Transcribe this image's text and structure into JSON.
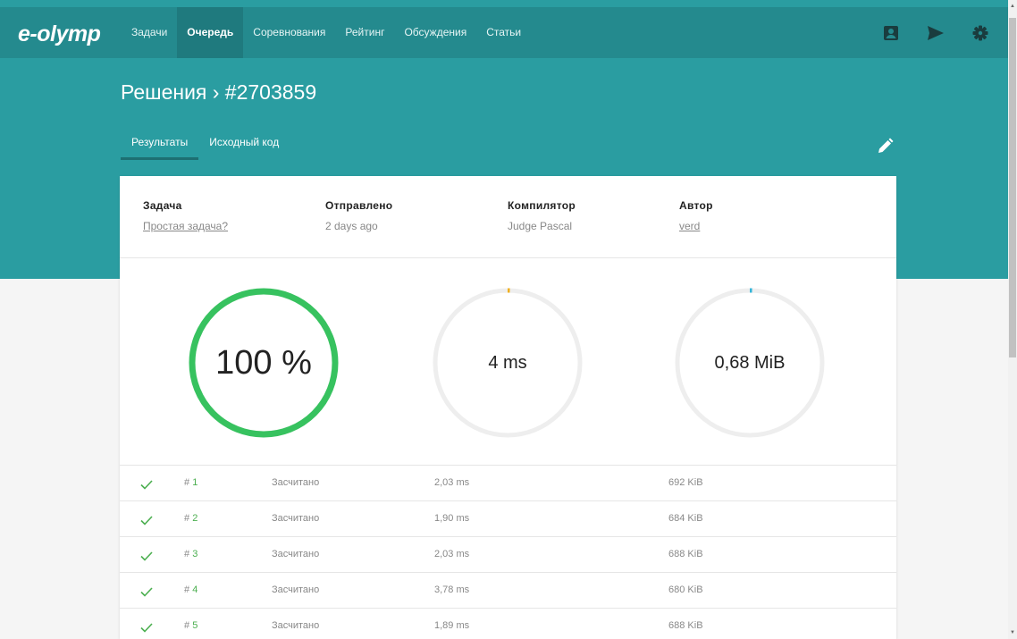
{
  "header": {
    "logo": "e-olymp",
    "nav": [
      "Задачи",
      "Очередь",
      "Соревнования",
      "Рейтинг",
      "Обсуждения",
      "Статьи"
    ]
  },
  "page": {
    "title": "Решения › #2703859",
    "tabs": [
      "Результаты",
      "Исходный код"
    ]
  },
  "info": {
    "task_label": "Задача",
    "task_value": "Простая задача?",
    "sent_label": "Отправлено",
    "sent_value": "2 days ago",
    "compiler_label": "Компилятор",
    "compiler_value": "Judge Pascal",
    "author_label": "Автор",
    "author_value": "verd"
  },
  "stats": {
    "score": "100 %",
    "score_fraction": 1.0,
    "score_color": "#37c25f",
    "time": "4 ms",
    "time_fraction": 0.005,
    "time_color": "#f0b020",
    "memory": "0,68 MiB",
    "memory_fraction": 0.005,
    "memory_color": "#35b5d8",
    "track_color": "#eeeeee"
  },
  "tests": [
    {
      "hash": "#",
      "num": "1",
      "status": "Засчитано",
      "time": "2,03 ms",
      "memory": "692 KiB"
    },
    {
      "hash": "#",
      "num": "2",
      "status": "Засчитано",
      "time": "1,90 ms",
      "memory": "684 KiB"
    },
    {
      "hash": "#",
      "num": "3",
      "status": "Засчитано",
      "time": "2,03 ms",
      "memory": "688 KiB"
    },
    {
      "hash": "#",
      "num": "4",
      "status": "Засчитано",
      "time": "3,78 ms",
      "memory": "680 KiB"
    },
    {
      "hash": "#",
      "num": "5",
      "status": "Засчитано",
      "time": "1,89 ms",
      "memory": "688 KiB"
    }
  ],
  "icons": {
    "profile": "profile-icon",
    "send": "send-icon",
    "settings": "gear-icon",
    "edit": "pencil-icon",
    "check": "check-icon"
  },
  "colors": {
    "teal": "#2a9da1",
    "teal_dark": "#248a8e",
    "success": "#4caf50"
  }
}
